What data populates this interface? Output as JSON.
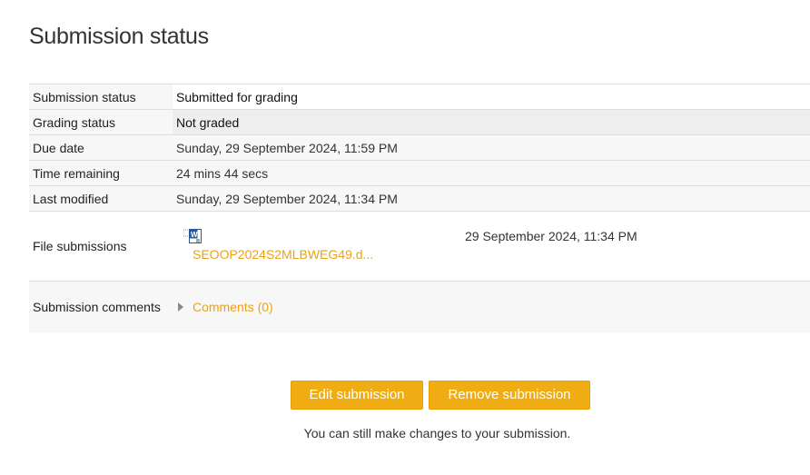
{
  "page_title": "Submission status",
  "rows": {
    "submission_status": {
      "label": "Submission status",
      "value": "Submitted for grading"
    },
    "grading_status": {
      "label": "Grading status",
      "value": "Not graded"
    },
    "due_date": {
      "label": "Due date",
      "value": "Sunday, 29 September 2024, 11:59 PM"
    },
    "time_remaining": {
      "label": "Time remaining",
      "value": "24 mins 44 secs"
    },
    "last_modified": {
      "label": "Last modified",
      "value": "Sunday, 29 September 2024, 11:34 PM"
    },
    "file_submissions": {
      "label": "File submissions",
      "file_name": "SEOOP2024S2MLBWEG49.d...",
      "file_date": "29 September 2024, 11:34 PM",
      "file_icon": "word-doc-icon"
    },
    "submission_comments": {
      "label": "Submission comments",
      "link": "Comments (0)"
    }
  },
  "actions": {
    "edit_label": "Edit submission",
    "remove_label": "Remove submission",
    "help_text": "You can still make changes to your submission."
  },
  "colors": {
    "accent": "#f0ad13",
    "link": "#e9a21a",
    "grading_bg": "#eeeeee"
  }
}
